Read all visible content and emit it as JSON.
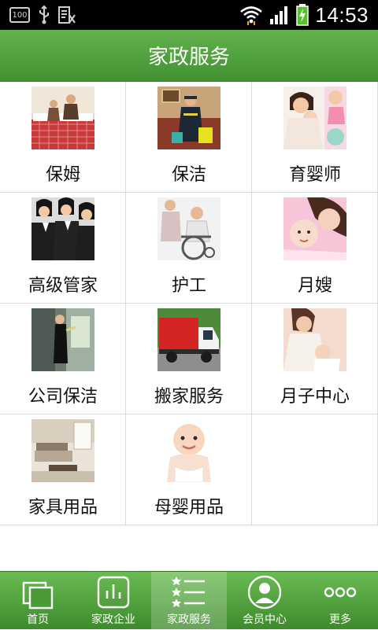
{
  "status_bar": {
    "badge": "100",
    "time": "14:53",
    "icons": [
      "battery-100-icon",
      "usb-icon",
      "android-notification-icon",
      "wifi-icon",
      "signal-icon",
      "battery-charging-icon"
    ]
  },
  "header": {
    "title": "家政服务"
  },
  "services": [
    {
      "label": "保姆",
      "icon": "nanny-photo"
    },
    {
      "label": "保洁",
      "icon": "cleaning-photo"
    },
    {
      "label": "育婴师",
      "icon": "childcare-photo"
    },
    {
      "label": "高级管家",
      "icon": "butler-photo"
    },
    {
      "label": "护工",
      "icon": "caregiver-photo"
    },
    {
      "label": "月嫂",
      "icon": "maternity-nurse-photo"
    },
    {
      "label": "公司保洁",
      "icon": "office-cleaning-photo"
    },
    {
      "label": "搬家服务",
      "icon": "moving-truck-photo"
    },
    {
      "label": "月子中心",
      "icon": "postpartum-center-photo"
    },
    {
      "label": "家具用品",
      "icon": "furniture-photo"
    },
    {
      "label": "母婴用品",
      "icon": "baby-products-photo"
    }
  ],
  "tabbar": {
    "active": 2,
    "items": [
      {
        "label": "首页",
        "icon": "home-icon"
      },
      {
        "label": "家政企业",
        "icon": "bar-chart-icon"
      },
      {
        "label": "家政服务",
        "icon": "list-icon"
      },
      {
        "label": "会员中心",
        "icon": "user-icon"
      },
      {
        "label": "更多",
        "icon": "more-icon"
      }
    ]
  },
  "colors": {
    "header_green": "#4f9f3c",
    "tab_green": "#4a9a37",
    "divider": "#dcdcdc"
  }
}
